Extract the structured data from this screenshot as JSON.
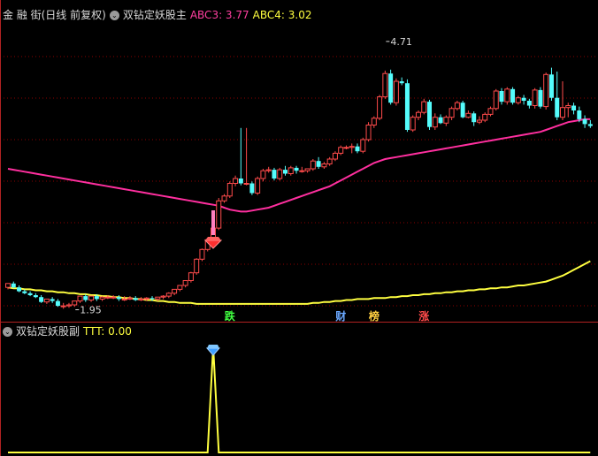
{
  "colors": {
    "background": "#000000",
    "up": "#ff4b4b",
    "down": "#54fcfc",
    "ma_magenta": "#ff2f9f",
    "ma_yellow": "#ffff40",
    "grid": "#8b0000",
    "indicator": "#ffff40"
  },
  "header_main": {
    "symbol": "金 融 街(日线 前复权)",
    "indicator_name": "双钻定妖股主",
    "abc3_label": "ABC3: 3.77",
    "abc4_label": "ABC4: 3.02"
  },
  "header_sub": {
    "indicator_name": "双钻定妖股副",
    "ttt_label": "TTT: 0.00"
  },
  "markers": [
    {
      "text": "跌",
      "index": 40,
      "color": "#40ff40"
    },
    {
      "text": "财",
      "index": 60,
      "color": "#6aa8ff"
    },
    {
      "text": "榜",
      "index": 66,
      "color": "#ffcf40"
    },
    {
      "text": "涨",
      "index": 75,
      "color": "#ff4b4b"
    }
  ],
  "chart_data": [
    {
      "type": "candlestick",
      "title": "",
      "xlabel": "",
      "ylabel": "",
      "ylim": [
        1.8,
        4.9
      ],
      "grid": true,
      "legend": "none",
      "x": [
        0,
        1,
        2,
        3,
        4,
        5,
        6,
        7,
        8,
        9,
        10,
        11,
        12,
        13,
        14,
        15,
        16,
        17,
        18,
        19,
        20,
        21,
        22,
        23,
        24,
        25,
        26,
        27,
        28,
        29,
        30,
        31,
        32,
        33,
        34,
        35,
        36,
        37,
        38,
        39,
        40,
        41,
        42,
        43,
        44,
        45,
        46,
        47,
        48,
        49,
        50,
        51,
        52,
        53,
        54,
        55,
        56,
        57,
        58,
        59,
        60,
        61,
        62,
        63,
        64,
        65,
        66,
        67,
        68,
        69,
        70,
        71,
        72,
        73,
        74,
        75,
        76,
        77,
        78,
        79,
        80,
        81,
        82,
        83,
        84,
        85,
        86,
        87,
        88,
        89,
        90,
        91,
        92,
        93,
        94,
        95,
        96,
        97,
        98,
        99,
        100,
        101,
        102,
        103,
        104,
        105
      ],
      "open": [
        2.18,
        2.22,
        2.18,
        2.14,
        2.12,
        2.1,
        2.08,
        2.03,
        2.06,
        2.04,
        1.99,
        1.99,
        2.0,
        2.04,
        2.09,
        2.05,
        2.09,
        2.06,
        2.08,
        2.08,
        2.08,
        2.06,
        2.06,
        2.07,
        2.05,
        2.06,
        2.07,
        2.06,
        2.08,
        2.09,
        2.12,
        2.16,
        2.2,
        2.25,
        2.33,
        2.47,
        2.57,
        2.67,
        2.79,
        3.07,
        3.12,
        3.25,
        3.3,
        3.25,
        3.25,
        3.15,
        3.3,
        3.38,
        3.39,
        3.3,
        3.39,
        3.35,
        3.41,
        3.38,
        3.38,
        3.4,
        3.48,
        3.42,
        3.45,
        3.5,
        3.56,
        3.62,
        3.62,
        3.63,
        3.58,
        3.7,
        3.85,
        3.92,
        4.14,
        4.38,
        4.08,
        4.3,
        4.28,
        3.8,
        3.93,
        3.98,
        4.09,
        3.83,
        3.93,
        3.87,
        3.93,
        4.02,
        4.08,
        3.93,
        3.97,
        3.88,
        3.9,
        3.96,
        4.02,
        4.2,
        4.09,
        4.22,
        4.08,
        4.13,
        4.1,
        4.05,
        4.21,
        4.04,
        4.37,
        4.13,
        3.93,
        4.03,
        4.05,
        4.0,
        3.91,
        3.86
      ],
      "high": [
        2.2,
        2.24,
        2.2,
        2.16,
        2.14,
        2.12,
        2.1,
        2.06,
        2.08,
        2.06,
        2.02,
        2.02,
        2.04,
        2.08,
        2.11,
        2.07,
        2.11,
        2.09,
        2.1,
        2.1,
        2.1,
        2.09,
        2.09,
        2.09,
        2.08,
        2.08,
        2.09,
        2.08,
        2.1,
        2.13,
        2.16,
        2.2,
        2.25,
        2.34,
        2.48,
        2.58,
        2.69,
        2.81,
        3.1,
        3.14,
        3.27,
        3.33,
        3.82,
        3.82,
        3.27,
        3.32,
        3.4,
        3.42,
        3.41,
        3.41,
        3.43,
        3.43,
        3.43,
        3.42,
        3.4,
        3.5,
        3.52,
        3.47,
        3.52,
        3.58,
        3.64,
        3.64,
        3.66,
        3.66,
        3.72,
        3.88,
        3.94,
        4.16,
        4.41,
        4.42,
        4.33,
        4.34,
        4.32,
        3.95,
        4.0,
        4.12,
        4.11,
        3.97,
        3.96,
        3.95,
        4.04,
        4.1,
        4.1,
        4.0,
        3.99,
        3.94,
        3.98,
        4.04,
        4.22,
        4.23,
        4.24,
        4.24,
        4.15,
        4.16,
        4.12,
        4.23,
        4.24,
        4.39,
        4.44,
        4.4,
        4.3,
        4.08,
        4.08,
        4.04,
        3.95,
        3.9
      ],
      "low": [
        2.16,
        2.17,
        2.13,
        2.11,
        2.09,
        2.07,
        2.02,
        2.01,
        2.02,
        1.98,
        1.96,
        1.97,
        1.98,
        2.02,
        2.03,
        2.03,
        2.04,
        2.04,
        2.06,
        2.06,
        2.04,
        2.04,
        2.05,
        2.04,
        2.04,
        2.04,
        2.04,
        2.04,
        2.06,
        2.07,
        2.1,
        2.14,
        2.18,
        2.23,
        2.31,
        2.45,
        2.55,
        2.65,
        2.77,
        3.05,
        3.1,
        3.22,
        3.23,
        3.23,
        3.13,
        3.13,
        3.27,
        3.36,
        3.28,
        3.28,
        3.33,
        3.33,
        3.35,
        3.36,
        3.36,
        3.38,
        3.4,
        3.4,
        3.43,
        3.48,
        3.54,
        3.6,
        3.56,
        3.56,
        3.56,
        3.68,
        3.82,
        3.9,
        4.12,
        4.06,
        4.05,
        4.26,
        3.78,
        3.78,
        3.9,
        3.96,
        3.8,
        3.8,
        3.86,
        3.84,
        3.9,
        4.0,
        3.92,
        3.92,
        3.84,
        3.86,
        3.88,
        3.94,
        4.0,
        4.06,
        4.06,
        4.06,
        4.06,
        4.06,
        4.02,
        4.02,
        4.02,
        4.01,
        4.1,
        3.9,
        3.9,
        3.93,
        3.96,
        3.88,
        3.82,
        3.82
      ],
      "close": [
        2.22,
        2.18,
        2.14,
        2.12,
        2.1,
        2.08,
        2.03,
        2.06,
        2.04,
        1.99,
        1.99,
        2.0,
        2.04,
        2.09,
        2.05,
        2.09,
        2.06,
        2.08,
        2.08,
        2.08,
        2.06,
        2.06,
        2.07,
        2.05,
        2.06,
        2.07,
        2.06,
        2.08,
        2.09,
        2.12,
        2.16,
        2.2,
        2.25,
        2.33,
        2.47,
        2.57,
        2.67,
        2.79,
        3.07,
        3.12,
        3.25,
        3.3,
        3.25,
        3.25,
        3.15,
        3.3,
        3.38,
        3.39,
        3.3,
        3.39,
        3.35,
        3.41,
        3.38,
        3.38,
        3.4,
        3.48,
        3.42,
        3.45,
        3.5,
        3.56,
        3.62,
        3.62,
        3.63,
        3.58,
        3.7,
        3.85,
        3.92,
        4.14,
        4.38,
        4.08,
        4.3,
        4.28,
        3.8,
        3.93,
        3.98,
        4.09,
        3.83,
        3.93,
        3.87,
        3.93,
        4.02,
        4.08,
        3.93,
        3.97,
        3.88,
        3.9,
        3.96,
        4.02,
        4.2,
        4.09,
        4.22,
        4.08,
        4.13,
        4.1,
        4.05,
        4.21,
        4.04,
        4.37,
        4.13,
        3.93,
        4.03,
        4.05,
        4.0,
        3.91,
        3.86,
        3.84
      ],
      "ma_magenta": [
        3.4,
        3.39,
        3.38,
        3.37,
        3.36,
        3.35,
        3.34,
        3.33,
        3.32,
        3.31,
        3.3,
        3.29,
        3.28,
        3.27,
        3.26,
        3.25,
        3.24,
        3.23,
        3.22,
        3.21,
        3.2,
        3.19,
        3.18,
        3.17,
        3.16,
        3.15,
        3.14,
        3.13,
        3.12,
        3.11,
        3.1,
        3.09,
        3.08,
        3.07,
        3.06,
        3.05,
        3.04,
        3.03,
        3.02,
        3.0,
        2.98,
        2.97,
        2.96,
        2.96,
        2.97,
        2.98,
        2.99,
        3.0,
        3.02,
        3.04,
        3.06,
        3.08,
        3.1,
        3.12,
        3.14,
        3.16,
        3.18,
        3.2,
        3.22,
        3.25,
        3.28,
        3.31,
        3.34,
        3.37,
        3.4,
        3.43,
        3.46,
        3.48,
        3.5,
        3.51,
        3.52,
        3.53,
        3.54,
        3.55,
        3.56,
        3.57,
        3.58,
        3.59,
        3.6,
        3.61,
        3.62,
        3.63,
        3.64,
        3.65,
        3.66,
        3.67,
        3.68,
        3.69,
        3.7,
        3.71,
        3.72,
        3.73,
        3.74,
        3.75,
        3.76,
        3.77,
        3.78,
        3.8,
        3.82,
        3.84,
        3.86,
        3.88,
        3.89,
        3.9,
        3.91,
        3.91
      ],
      "ma_yellow": [
        2.18,
        2.17,
        2.17,
        2.16,
        2.16,
        2.15,
        2.15,
        2.14,
        2.14,
        2.13,
        2.13,
        2.12,
        2.12,
        2.11,
        2.11,
        2.1,
        2.1,
        2.09,
        2.09,
        2.08,
        2.08,
        2.07,
        2.07,
        2.06,
        2.06,
        2.05,
        2.05,
        2.04,
        2.04,
        2.03,
        2.03,
        2.02,
        2.02,
        2.02,
        2.01,
        2.01,
        2.01,
        2.01,
        2.01,
        2.01,
        2.01,
        2.01,
        2.01,
        2.01,
        2.01,
        2.01,
        2.01,
        2.01,
        2.01,
        2.01,
        2.01,
        2.01,
        2.01,
        2.01,
        2.01,
        2.02,
        2.02,
        2.03,
        2.03,
        2.04,
        2.04,
        2.05,
        2.05,
        2.06,
        2.06,
        2.06,
        2.07,
        2.07,
        2.07,
        2.08,
        2.08,
        2.09,
        2.09,
        2.1,
        2.1,
        2.11,
        2.11,
        2.12,
        2.12,
        2.13,
        2.13,
        2.14,
        2.14,
        2.15,
        2.15,
        2.16,
        2.16,
        2.17,
        2.17,
        2.18,
        2.18,
        2.19,
        2.2,
        2.2,
        2.21,
        2.22,
        2.23,
        2.24,
        2.26,
        2.28,
        2.3,
        2.33,
        2.36,
        2.39,
        2.42,
        2.45
      ],
      "annotations": [
        {
          "text": "4.71",
          "index": 68,
          "value": 4.71
        },
        {
          "text": "1.95",
          "index": 12,
          "value": 1.95
        }
      ]
    },
    {
      "type": "line",
      "title": "",
      "xlabel": "",
      "ylabel": "",
      "ylim": [
        0,
        1
      ],
      "grid": false,
      "legend": "none",
      "series": [
        {
          "values": [
            0,
            0,
            0,
            0,
            0,
            0,
            0,
            0,
            0,
            0,
            0,
            0,
            0,
            0,
            0,
            0,
            0,
            0,
            0,
            0,
            0,
            0,
            0,
            0,
            0,
            0,
            0,
            0,
            0,
            0,
            0,
            0,
            0,
            0,
            0,
            0,
            0,
            1,
            0,
            0,
            0,
            0,
            0,
            0,
            0,
            0,
            0,
            0,
            0,
            0,
            0,
            0,
            0,
            0,
            0,
            0,
            0,
            0,
            0,
            0,
            0,
            0,
            0,
            0,
            0,
            0,
            0,
            0,
            0,
            0,
            0,
            0,
            0,
            0,
            0,
            0,
            0,
            0,
            0,
            0,
            0,
            0,
            0,
            0,
            0,
            0,
            0,
            0,
            0,
            0,
            0,
            0,
            0,
            0,
            0,
            0,
            0,
            0,
            0,
            0,
            0,
            0,
            0,
            0,
            0,
            0
          ]
        }
      ]
    }
  ]
}
